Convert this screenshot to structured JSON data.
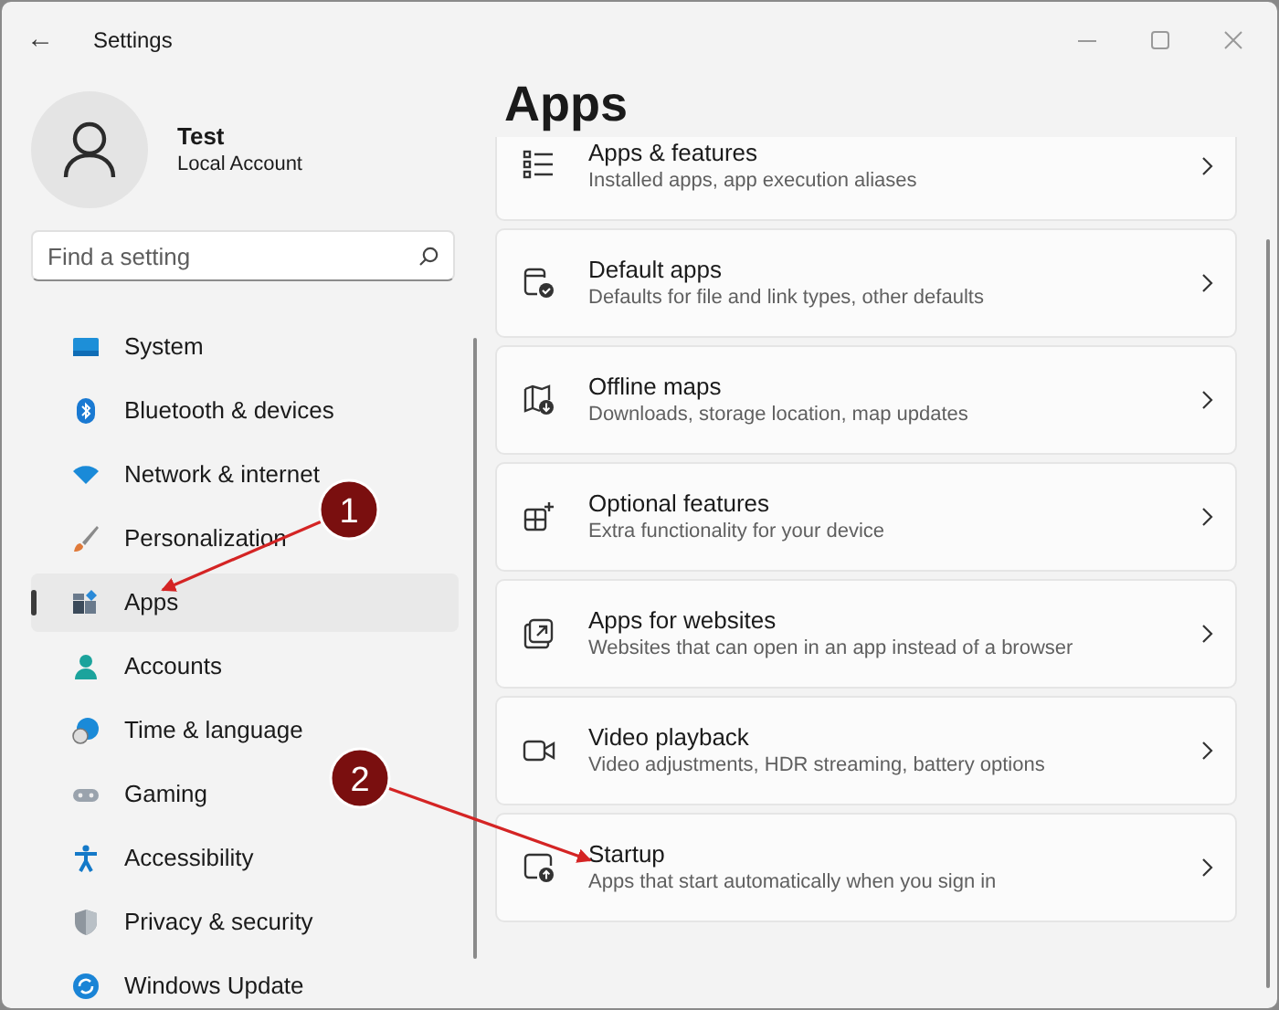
{
  "window": {
    "title": "Settings",
    "back": "←"
  },
  "account": {
    "name": "Test",
    "type": "Local Account"
  },
  "search": {
    "placeholder": "Find a setting"
  },
  "sidebar": {
    "items": [
      {
        "label": "System",
        "selected": false
      },
      {
        "label": "Bluetooth & devices",
        "selected": false
      },
      {
        "label": "Network & internet",
        "selected": false
      },
      {
        "label": "Personalization",
        "selected": false
      },
      {
        "label": "Apps",
        "selected": true
      },
      {
        "label": "Accounts",
        "selected": false
      },
      {
        "label": "Time & language",
        "selected": false
      },
      {
        "label": "Gaming",
        "selected": false
      },
      {
        "label": "Accessibility",
        "selected": false
      },
      {
        "label": "Privacy & security",
        "selected": false
      },
      {
        "label": "Windows Update",
        "selected": false
      }
    ]
  },
  "page": {
    "title": "Apps",
    "cards": [
      {
        "title": "Apps & features",
        "subtitle": "Installed apps, app execution aliases"
      },
      {
        "title": "Default apps",
        "subtitle": "Defaults for file and link types, other defaults"
      },
      {
        "title": "Offline maps",
        "subtitle": "Downloads, storage location, map updates"
      },
      {
        "title": "Optional features",
        "subtitle": "Extra functionality for your device"
      },
      {
        "title": "Apps for websites",
        "subtitle": "Websites that can open in an app instead of a browser"
      },
      {
        "title": "Video playback",
        "subtitle": "Video adjustments, HDR streaming, battery options"
      },
      {
        "title": "Startup",
        "subtitle": "Apps that start automatically when you sign in"
      }
    ]
  },
  "annotations": [
    {
      "label": "1"
    },
    {
      "label": "2"
    }
  ]
}
